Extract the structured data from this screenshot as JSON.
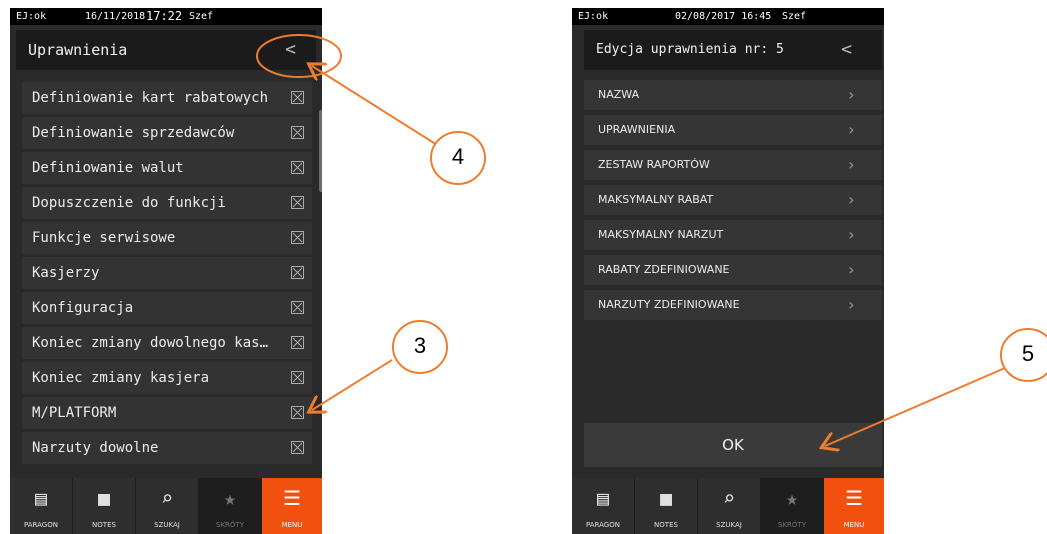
{
  "left_screen": {
    "status": {
      "ej": "EJ:ok",
      "date": "16/11/2018",
      "time": "17:22",
      "user": "Szef"
    },
    "header": {
      "title": "Uprawnienia",
      "back": "<"
    },
    "items": [
      {
        "label": "Definiowanie kart rabatowych"
      },
      {
        "label": "Definiowanie sprzedawców"
      },
      {
        "label": "Definiowanie walut"
      },
      {
        "label": "Dopuszczenie do funkcji"
      },
      {
        "label": "Funkcje serwisowe"
      },
      {
        "label": "Kasjerzy"
      },
      {
        "label": "Konfiguracja"
      },
      {
        "label": "Koniec zmiany dowolnego kas…"
      },
      {
        "label": "Koniec zmiany kasjera"
      },
      {
        "label": "M/PLATFORM"
      },
      {
        "label": "Narzuty dowolne"
      }
    ]
  },
  "right_screen": {
    "status": {
      "ej": "EJ:ok",
      "datetime": "02/08/2017 16:45",
      "user": "Szef"
    },
    "header": {
      "title": "Edycja uprawnienia nr: 5",
      "back": "<"
    },
    "items": [
      {
        "label": "NAZWA"
      },
      {
        "label": "UPRAWNIENIA"
      },
      {
        "label": "ZESTAW RAPORTÓW"
      },
      {
        "label": "MAKSYMALNY RABAT"
      },
      {
        "label": "MAKSYMALNY NARZUT"
      },
      {
        "label": "RABATY ZDEFINIOWANE"
      },
      {
        "label": "NARZUTY ZDEFINIOWANE"
      }
    ],
    "ok_label": "OK"
  },
  "nav": [
    {
      "label": "PARAGON",
      "icon": "receipt-icon"
    },
    {
      "label": "NOTES",
      "icon": "notes-icon"
    },
    {
      "label": "SZUKAJ",
      "icon": "search-icon"
    },
    {
      "label": "SKRÓTY",
      "icon": "star-icon"
    },
    {
      "label": "MENU",
      "icon": "menu-icon"
    }
  ],
  "annotations": [
    "4",
    "3",
    "5"
  ],
  "colors": {
    "accent": "#f2500f",
    "annotation": "#ed7d31",
    "screen_bg": "#2a2a2a",
    "row_bg": "#333333"
  }
}
